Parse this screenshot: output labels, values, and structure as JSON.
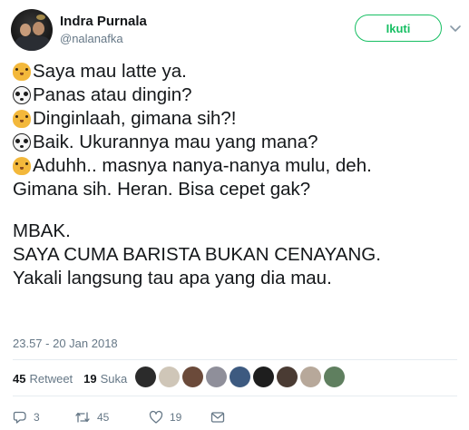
{
  "author": {
    "name": "Indra Purnala",
    "handle": "@nalanafka",
    "follow_label": "Ikuti"
  },
  "tweet": {
    "lines": [
      {
        "emoji": "tiger-emoji",
        "text": "Saya mau latte ya."
      },
      {
        "emoji": "panda-emoji",
        "text": "Panas atau dingin?"
      },
      {
        "emoji": "tiger-emoji",
        "text": "Dinginlaah, gimana sih?!"
      },
      {
        "emoji": "panda-emoji",
        "text": "Baik. Ukurannya mau yang mana?"
      },
      {
        "emoji": "tiger-emoji",
        "text": "Aduhh.. masnya nanya-nanya mulu, deh."
      },
      {
        "emoji": "",
        "text": "Gimana sih. Heran. Bisa cepet gak?"
      },
      {
        "emoji": "",
        "text": ""
      },
      {
        "emoji": "",
        "text": "MBAK."
      },
      {
        "emoji": "",
        "text": "SAYA CUMA BARISTA BUKAN CENAYANG."
      },
      {
        "emoji": "",
        "text": "Yakali langsung tau apa yang dia mau."
      }
    ],
    "timestamp": "23.57 - 20 Jan 2018"
  },
  "stats": {
    "retweet_count": "45",
    "retweet_label": "Retweet",
    "like_count": "19",
    "like_label": "Suka"
  },
  "likers": [
    {
      "color": "#2b2b2b"
    },
    {
      "color": "#cfc6b8"
    },
    {
      "color": "#6b4a3a"
    },
    {
      "color": "#8f8f9a"
    },
    {
      "color": "#3d5a80"
    },
    {
      "color": "#1e1e1e"
    },
    {
      "color": "#4a3b33"
    },
    {
      "color": "#b7a89a"
    },
    {
      "color": "#5f7f5f"
    }
  ],
  "actions": {
    "reply_count": "3",
    "retweet_count": "45",
    "like_count": "19"
  },
  "colors": {
    "follow_green": "#17bf63",
    "muted": "#657786",
    "text": "#14171a"
  }
}
